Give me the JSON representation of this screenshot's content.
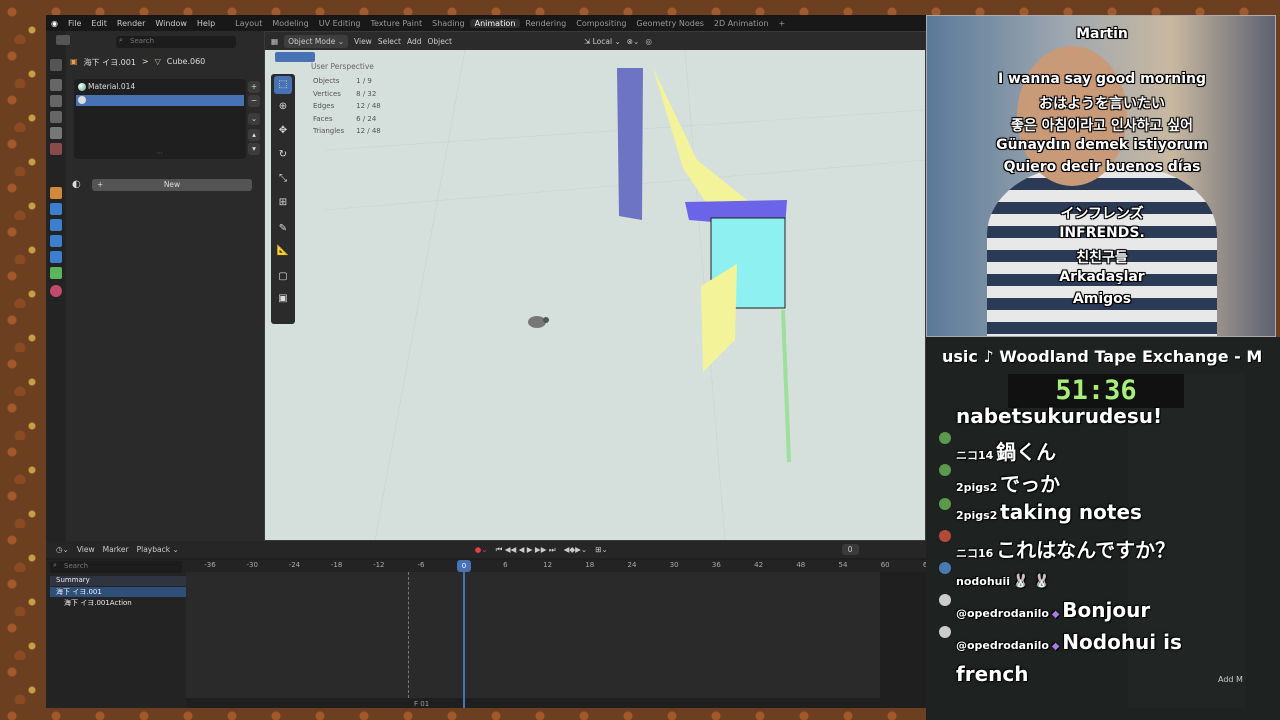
{
  "menubar": {
    "items": [
      "File",
      "Edit",
      "Render",
      "Window",
      "Help"
    ],
    "workspaces": [
      "Layout",
      "Modeling",
      "UV Editing",
      "Texture Paint",
      "Shading",
      "Animation",
      "Rendering",
      "Compositing",
      "Geometry Nodes",
      "2D Animation"
    ],
    "active_workspace": "Animation",
    "add_symbol": "+"
  },
  "properties": {
    "search_placeholder": "Search",
    "breadcrumb": [
      "海下 イヨ.001",
      ">",
      "Cube.060"
    ],
    "material_slots": [
      "Material.014",
      ""
    ],
    "new_button": "New",
    "add_symbol": "+",
    "remove_symbol": "−"
  },
  "viewport": {
    "header": {
      "mode": "Object Mode",
      "menus": [
        "View",
        "Select",
        "Add",
        "Object"
      ],
      "orientation": "Local"
    },
    "title": "User Perspective",
    "stats": [
      {
        "label": "Objects",
        "value": "1 / 9"
      },
      {
        "label": "Vertices",
        "value": "8 / 32"
      },
      {
        "label": "Edges",
        "value": "12 / 48"
      },
      {
        "label": "Faces",
        "value": "6 / 24"
      },
      {
        "label": "Triangles",
        "value": "12 / 48"
      }
    ]
  },
  "timeline": {
    "menus": [
      "View",
      "Marker",
      "Playback"
    ],
    "search_placeholder": "Search",
    "current_frame": "0",
    "frame_field": "0",
    "ruler": [
      "-36",
      "-30",
      "-24",
      "-18",
      "-12",
      "-6",
      "0",
      "6",
      "12",
      "18",
      "24",
      "30",
      "36",
      "42",
      "48",
      "54",
      "60",
      "66"
    ],
    "channels": [
      {
        "label": "Summary"
      },
      {
        "label": "海下 イヨ.001"
      },
      {
        "label": "海下 イヨ.001Action"
      }
    ],
    "bottom_label": "F 01"
  },
  "webcam": {
    "name": "Martin",
    "lines1": [
      "I wanna say good morning",
      "おはようを言いたい",
      "좋은 아침이라고 인사하고 싶어",
      "Günaydın demek istiyorum",
      "Quiero decir buenos días"
    ],
    "lines2": [
      "インフレンズ",
      "INFRENDS.",
      "친친구들",
      "Arkadaşlar",
      "Amigos"
    ]
  },
  "now_playing": "usic ♪ Woodland Tape Exchange - M",
  "timer": "51:36",
  "chat": [
    {
      "name": "",
      "text": "nabetsukurudesu!"
    },
    {
      "name": "ニコ14",
      "text": "鍋くん"
    },
    {
      "name": "2pigs2",
      "text": "でっか"
    },
    {
      "name": "2pigs2",
      "text": "taking notes"
    },
    {
      "name": "ニコ16",
      "text": "これはなんですか？"
    },
    {
      "name": "nodohuii",
      "text": ""
    },
    {
      "name": "@opedrodanilo",
      "text": "Bonjour"
    },
    {
      "name": "@opedrodanilo",
      "text": "Nodohui is"
    },
    {
      "name": "",
      "text": "french"
    }
  ],
  "outliner_add": "Add M"
}
